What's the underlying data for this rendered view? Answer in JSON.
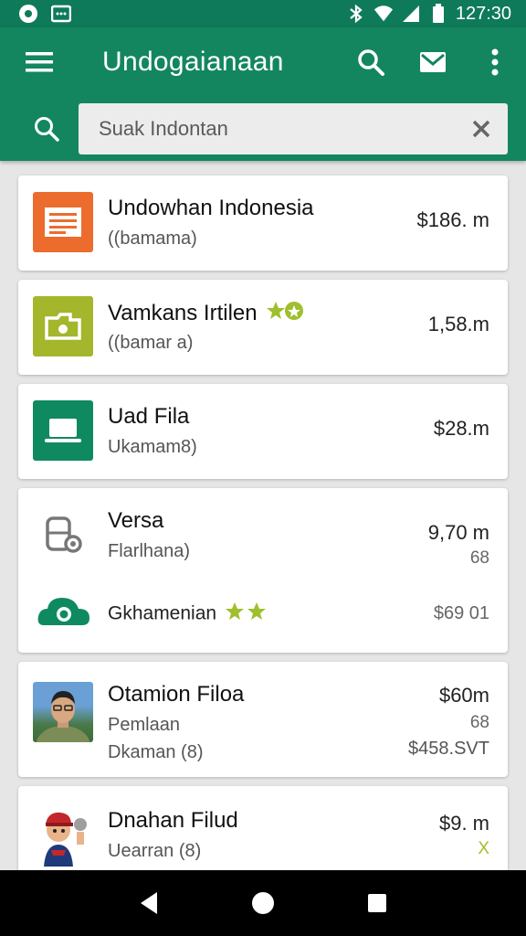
{
  "status_bar": {
    "time": "127:30",
    "icons": [
      "notification-icon",
      "message-icon",
      "bluetooth-icon",
      "wifi-icon",
      "signal-icon",
      "battery-icon"
    ]
  },
  "app_bar": {
    "title": "Undogaianaan",
    "actions": [
      "search-icon",
      "mail-icon",
      "more-vert-icon"
    ]
  },
  "search": {
    "placeholder": "Suak Indontan",
    "value": ""
  },
  "colors": {
    "primary": "#13865f",
    "status": "#0f7a5a"
  },
  "items": [
    {
      "title": "Undowhan Indonesia",
      "subtitle": "((bamama)",
      "price": "$186. m",
      "icon": "document-icon",
      "icon_bg": "#ec6c2e"
    },
    {
      "title": "Vamkans Irtilen",
      "subtitle": "((bamar a)",
      "price": "1,58.m",
      "icon": "folder-share-icon",
      "icon_bg": "#a4b62c",
      "badge": "star-badge-icon"
    },
    {
      "title": "Uad Fila",
      "subtitle": "Ukamam8)",
      "price": "$28.m",
      "icon": "laptop-icon",
      "icon_bg": "#0f8a60"
    },
    {
      "title": "Versa",
      "subtitle": "Flarlhana)",
      "price": "9,70 m",
      "price_sub": "68",
      "icon": "storage-icon",
      "extra": {
        "title": "Gkhamenian",
        "price": "$69 01",
        "icon": "cloud-camera-icon"
      }
    },
    {
      "title": "Otamion Filoa",
      "subtitle": "Pemlaan",
      "subtitle2": "Dkaman (8)",
      "price": "$60m",
      "price_sub": "68",
      "price_sub2": "$458.SVT",
      "icon": "person-photo"
    },
    {
      "title": "Dnahan Filud",
      "subtitle": "Uearran (8)",
      "price": "$9. m",
      "price_sub": "X",
      "icon": "cartoon-avatar"
    }
  ],
  "nav": [
    "back-icon",
    "home-icon",
    "recents-icon"
  ]
}
